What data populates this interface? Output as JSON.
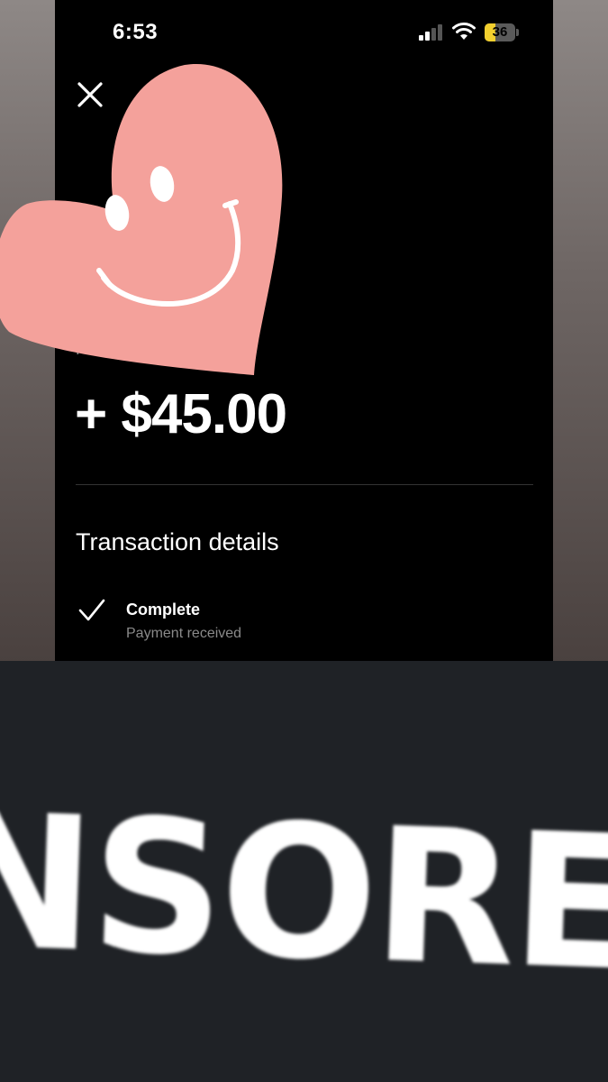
{
  "status_bar": {
    "time": "6:53",
    "battery_level": "36",
    "battery_color": "#f2cf2e"
  },
  "header": {
    "close_icon": "close-icon"
  },
  "transaction": {
    "note_label": "For m",
    "amount": "+ $45.00",
    "details_title": "Transaction details",
    "status": "Complete",
    "status_detail": "Payment received"
  },
  "overlays": {
    "sticker": "heart-smiley-sticker",
    "sticker_color": "#f4a19b",
    "banner_text": "NSORE"
  }
}
